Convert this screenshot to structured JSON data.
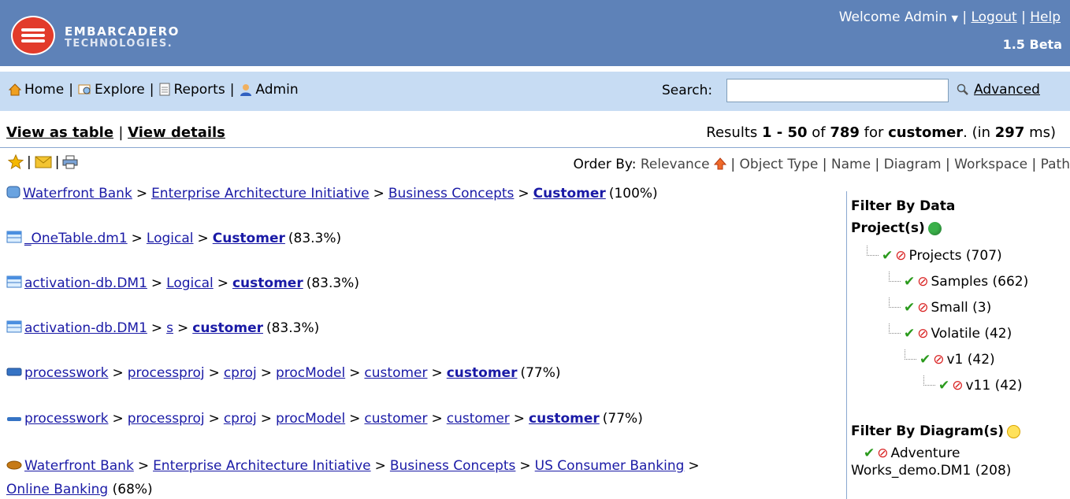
{
  "header": {
    "logo_line1": "EMBARCADERO",
    "logo_line2": "TECHNOLOGIES.",
    "welcome": "Welcome Admin",
    "logout": "Logout",
    "help": "Help",
    "version": "1.5 Beta",
    "bg_color": "#5e82b8"
  },
  "nav": {
    "items": [
      {
        "label": "Home",
        "icon": "home-icon"
      },
      {
        "label": "Explore",
        "icon": "explore-icon"
      },
      {
        "label": "Reports",
        "icon": "reports-icon"
      },
      {
        "label": "Admin",
        "icon": "admin-icon"
      }
    ],
    "search_label": "Search:",
    "search_value": "",
    "advanced": "Advanced",
    "bg_color": "#c7dcf3"
  },
  "results_bar": {
    "view_table": "View as table",
    "view_details": "View details",
    "prefix": "Results ",
    "range": "1 - 50",
    "of": " of ",
    "total": "789",
    "for": " for ",
    "query": "customer",
    "in": ". (in ",
    "time": "297",
    "ms": " ms)"
  },
  "order_by": {
    "label": "Order By:",
    "options": [
      "Relevance",
      "Object Type",
      "Name",
      "Diagram",
      "Workspace",
      "Path"
    ]
  },
  "results": [
    {
      "icon": "entity-icon",
      "crumbs": [
        "Waterfront Bank",
        "Enterprise Architecture Initiative",
        "Business Concepts"
      ],
      "target": "Customer",
      "score": "(100%)"
    },
    {
      "icon": "table-icon",
      "crumbs": [
        "_OneTable.dm1",
        "Logical"
      ],
      "target": "Customer",
      "score": "(83.3%)"
    },
    {
      "icon": "table-icon",
      "crumbs": [
        "activation-db.DM1",
        "Logical"
      ],
      "target": "customer",
      "score": "(83.3%)"
    },
    {
      "icon": "table-icon",
      "crumbs": [
        "activation-db.DM1",
        "s"
      ],
      "target": "customer",
      "score": "(83.3%)"
    },
    {
      "icon": "process-icon",
      "crumbs": [
        "processwork",
        "processproj",
        "cproj",
        "procModel",
        "customer"
      ],
      "target": "customer",
      "score": "(77%)"
    },
    {
      "icon": "process-flat-icon",
      "crumbs": [
        "processwork",
        "processproj",
        "cproj",
        "procModel",
        "customer",
        "customer"
      ],
      "target": "customer",
      "score": "(77%)"
    },
    {
      "icon": "concept-icon",
      "crumbs": [
        "Waterfront Bank",
        "Enterprise Architecture Initiative",
        "Business Concepts",
        "US Consumer Banking"
      ],
      "target": "",
      "score": ""
    }
  ],
  "last_row_continuation": "Online Banking (68%)",
  "filter": {
    "title": "Filter By Data",
    "projects_label": "Project(s)",
    "tree": [
      {
        "label": "Projects (707)",
        "level": 0
      },
      {
        "label": "Samples (662)",
        "level": 1
      },
      {
        "label": "Small (3)",
        "level": 1
      },
      {
        "label": "Volatile (42)",
        "level": 1
      },
      {
        "label": "v1 (42)",
        "level": 2
      },
      {
        "label": "v11 (42)",
        "level": 3
      }
    ],
    "diagram_label": "Filter By Diagram(s)",
    "diagram_item_line1": "Adventure",
    "diagram_item_line2": "Works_demo.DM1 (208)"
  }
}
